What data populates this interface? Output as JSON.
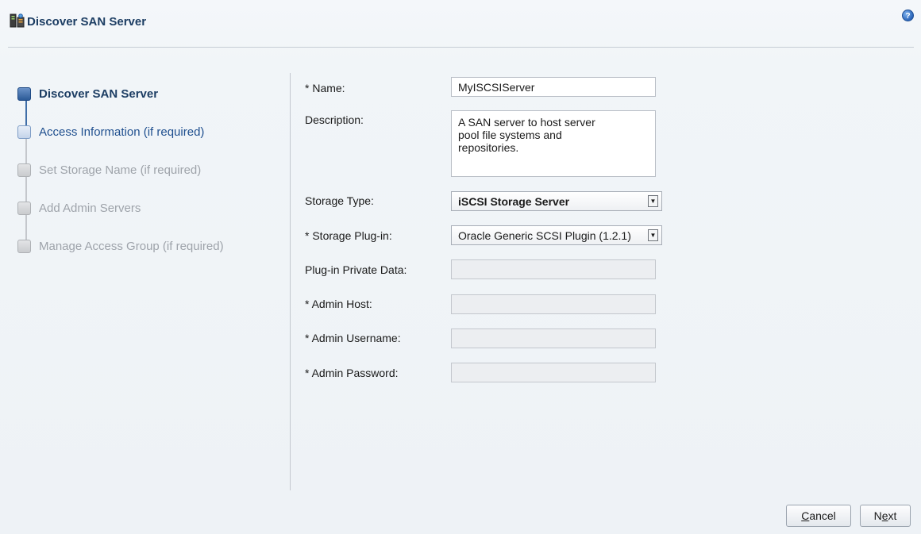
{
  "header": {
    "title": "Discover SAN Server",
    "help_icon": "help-icon",
    "help_glyph": "?"
  },
  "train": {
    "steps": [
      {
        "label": "Discover SAN Server",
        "state": "current"
      },
      {
        "label": "Access Information (if required)",
        "state": "next"
      },
      {
        "label": "Set Storage Name (if required)",
        "state": "disabled"
      },
      {
        "label": "Add Admin Servers",
        "state": "disabled"
      },
      {
        "label": "Manage Access Group (if required)",
        "state": "disabled"
      }
    ]
  },
  "form": {
    "name_label": "* Name:",
    "name_value": "MyISCSIServer",
    "description_label": "Description:",
    "description_value": "A SAN server to host server\npool file systems and\nrepositories.",
    "storage_type_label": "Storage Type:",
    "storage_type_value": "iSCSI Storage Server",
    "storage_plugin_label": "* Storage Plug-in:",
    "storage_plugin_value": "Oracle Generic SCSI Plugin (1.2.1)",
    "plugin_private_data_label": "Plug-in Private Data:",
    "plugin_private_data_value": "",
    "admin_host_label": "* Admin Host:",
    "admin_host_value": "",
    "admin_username_label": "* Admin Username:",
    "admin_username_value": "",
    "admin_password_label": "* Admin Password:",
    "admin_password_value": ""
  },
  "buttons": {
    "cancel_mnemonic": "C",
    "cancel_rest": "ancel",
    "next_first": "N",
    "next_mnemonic": "e",
    "next_rest": "xt"
  },
  "colors": {
    "title": "#1c3d63",
    "current_step": "#1c3d63",
    "next_step": "#1f4f8f",
    "disabled_step": "#9ea3aa",
    "background": "#f1f5f8"
  }
}
